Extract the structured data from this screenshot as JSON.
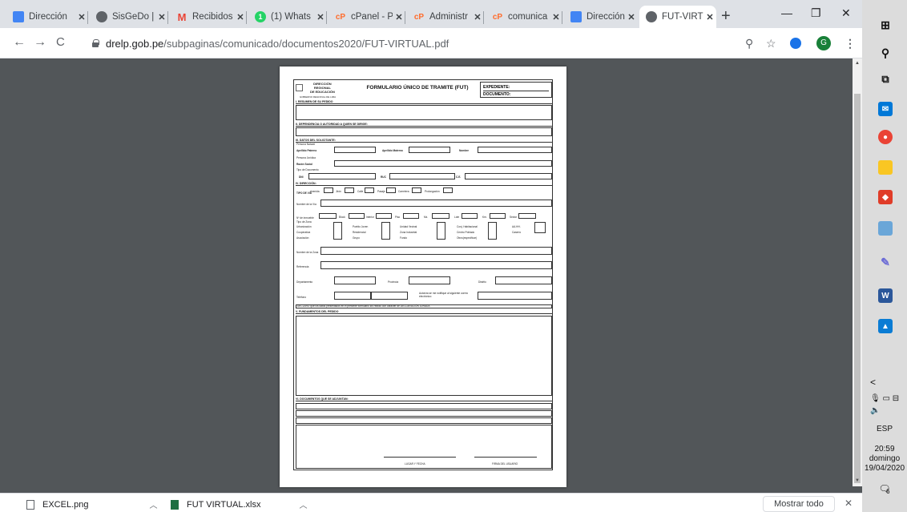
{
  "tabs": [
    {
      "title": "Dirección",
      "favicon": "grid",
      "color": "#4285f4"
    },
    {
      "title": "SisGeDo |",
      "favicon": "globe",
      "color": "#5f6368"
    },
    {
      "title": "Recibidos",
      "favicon": "gmail",
      "color": "#ea4335"
    },
    {
      "title": "(1) Whats",
      "favicon": "whatsapp",
      "color": "#25d366"
    },
    {
      "title": "cPanel - P",
      "favicon": "cpanel",
      "color": "#ff6c2c"
    },
    {
      "title": "Administr",
      "favicon": "cpanel",
      "color": "#ff6c2c"
    },
    {
      "title": "comunica",
      "favicon": "cpanel",
      "color": "#ff6c2c"
    },
    {
      "title": "Dirección",
      "favicon": "grid",
      "color": "#4285f4"
    },
    {
      "title": "FUT-VIRTU",
      "favicon": "globe",
      "color": "#5f6368"
    }
  ],
  "address": {
    "domain": "drelp.gob.pe",
    "path": "/subpaginas/comunicado/documentos2020/FUT-VIRTUAL.pdf"
  },
  "profile_initial": "G",
  "form": {
    "logo_line1": "DIRECCIÓN REGIONAL",
    "logo_line2": "DE EDUCACIÓN",
    "logo_sub": "GOBIERNO REGIONAL DE LIMA",
    "title": "FORMULARIO ÚNICO DE TRAMITE (FUT)",
    "expediente": "EXPEDIENTE:",
    "documento": "DOCUMENTO:",
    "sec1": "I. RESUMEN DE SU PEDIDO",
    "sec2": "II. DEPENDENCIA O AUTORIDAD A QUIEN SE DIRIGE:",
    "sec3": "III. DATOS DEL SOLICITANTE:",
    "persona_natural": "Persona Natural",
    "apellido_paterno": "Apellido Paterno",
    "apellido_materno": "Apellido Materno",
    "nombre": "Nombre",
    "persona_juridica": "Persona Jurídica",
    "razon_social": "Razón Social",
    "tipo_documento": "Tipo de Documento",
    "dni": "DNI",
    "ruc": "RUC",
    "ce": "C.E.",
    "sec4": "IV. DIRECCIÓN:",
    "tipo_via": "TIPO DE VIA",
    "vias": [
      "Avenida",
      "Jirón",
      "Calle",
      "Pasaje",
      "Carretera",
      "Prolongación"
    ],
    "nombre_via": "Nombre de la Vía",
    "nro": "Nº de inmueble",
    "nums": [
      "Block",
      "Interior",
      "Piso",
      "Mz.",
      "Lote",
      "Km.",
      "Sector"
    ],
    "tipo_zona": "Tipo de Zona",
    "zonas_c1": [
      "Urbanización",
      "Cooperativa",
      "Asociación"
    ],
    "zonas_c2": [
      "Pueblo Joven",
      "Residencial",
      "Grupo"
    ],
    "zonas_c3": [
      "Unidad Vecinal",
      "Zona Industrial",
      "Fundo"
    ],
    "zonas_c4": [
      "Conj. Habitacional",
      "Centro Poblado",
      "Otros(especificar)"
    ],
    "zonas_c5": [
      "AA.HH.",
      "Caserío"
    ],
    "nombre_zona": "Nombre de la Zona",
    "referencia": "Referencia",
    "departamento": "Departamento",
    "provincia": "Provincia",
    "distrito": "Distrito",
    "telefono": "Teléfono",
    "autoriza": "Autoriza se me notifique al siguiente correo electrónico",
    "declaro": "DECLARO que los datos presentados en el presente formulario los realizo con carácter de DECLARACIÓN JURADA",
    "sec5": "V. FUNDAMENTOS DEL PEDIDO",
    "sec6": "VI. DOCUMENTOS QUE SE ADJUNTAN:",
    "lugar_fecha": "LUGAR Y FECHA",
    "firma": "FIRMA DEL USUARIO"
  },
  "downloads": [
    {
      "name": "EXCEL.png",
      "type": "image"
    },
    {
      "name": "FUT VIRTUAL.xlsx",
      "type": "excel"
    }
  ],
  "show_all": "Mostrar todo",
  "tray": {
    "lang": "ESP",
    "time": "20:59",
    "day": "domingo",
    "date": "19/04/2020",
    "notif_count": "6"
  }
}
